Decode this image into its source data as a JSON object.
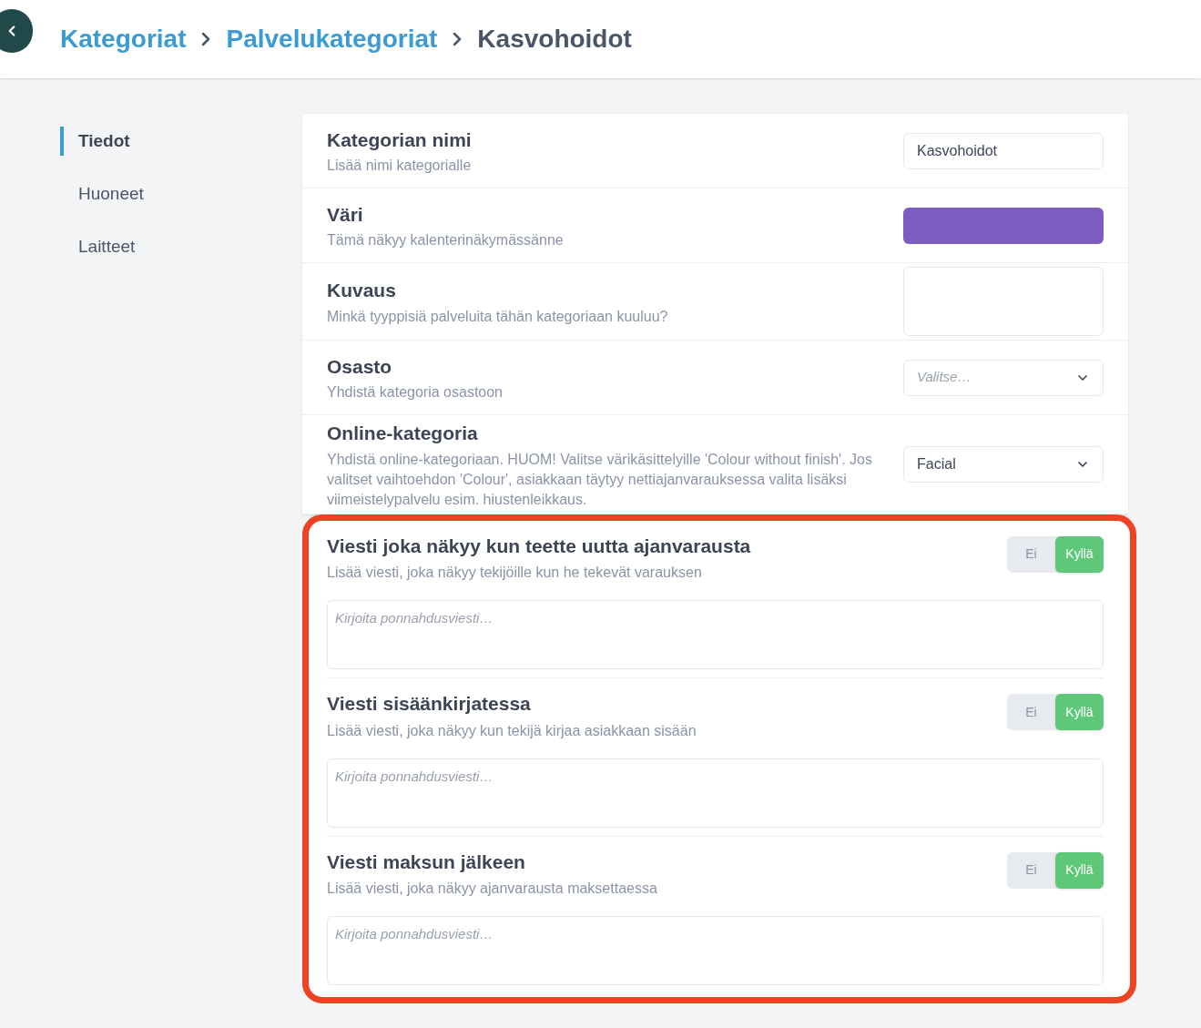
{
  "breadcrumb": [
    {
      "label": "Kategoriat",
      "kind": "link"
    },
    {
      "label": "Palvelukategoriat",
      "kind": "link"
    },
    {
      "label": "Kasvohoidot",
      "kind": "current"
    }
  ],
  "sidebar": {
    "items": [
      {
        "label": "Tiedot",
        "selected": true
      },
      {
        "label": "Huoneet",
        "selected": false
      },
      {
        "label": "Laitteet",
        "selected": false
      }
    ]
  },
  "fields": [
    {
      "kind": "text",
      "title": "Kategorian nimi",
      "subtitle": "Lisää nimi kategorialle",
      "value": "Kasvohoidot"
    },
    {
      "kind": "color",
      "title": "Väri",
      "subtitle": "Tämä näkyy kalenterinäkymässänne",
      "color": "#7c5cbf"
    },
    {
      "kind": "textarea",
      "title": "Kuvaus",
      "subtitle": "Minkä tyyppisiä palveluita tähän kategoriaan kuuluu?"
    },
    {
      "kind": "select",
      "title": "Osasto",
      "subtitle": "Yhdistä kategoria osastoon",
      "placeholder": "Valitse…"
    },
    {
      "kind": "select",
      "title": "Online-kategoria",
      "subtitle": "Yhdistä online-kategoriaan. HUOM! Valitse värikäsittelyille 'Colour without finish'. Jos valitset vaihtoehdon 'Colour', asiakkaan täytyy nettiajanvarauksessa valita lisäksi viimeistelypalvelu esim. hiustenleikkaus.",
      "value": "Facial"
    }
  ],
  "messages": [
    {
      "title": "Viesti joka näkyy kun teette uutta ajanvarausta",
      "subtitle": "Lisää viesti, joka näkyy tekijöille kun he tekevät varauksen",
      "options": [
        {
          "label": "Ei",
          "selected": false
        },
        {
          "label": "Kyllä",
          "selected": true
        }
      ],
      "placeholder": "Kirjoita ponnahdusviesti…"
    },
    {
      "title": "Viesti sisäänkirjatessa",
      "subtitle": "Lisää viesti, joka näkyy kun tekijä kirjaa asiakkaan sisään",
      "options": [
        {
          "label": "Ei",
          "selected": false
        },
        {
          "label": "Kyllä",
          "selected": true
        }
      ],
      "placeholder": "Kirjoita ponnahdusviesti…"
    },
    {
      "title": "Viesti maksun jälkeen",
      "subtitle": "Lisää viesti, joka näkyy ajanvarausta maksettaessa",
      "options": [
        {
          "label": "Ei",
          "selected": false
        },
        {
          "label": "Kyllä",
          "selected": true
        }
      ],
      "placeholder": "Kirjoita ponnahdusviesti…"
    }
  ]
}
